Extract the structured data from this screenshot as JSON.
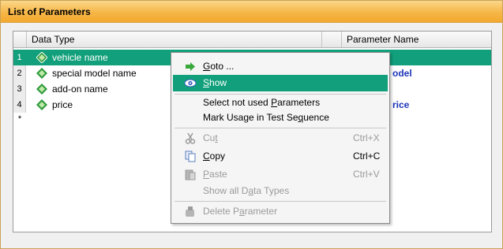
{
  "panel": {
    "title": "List of Parameters"
  },
  "table": {
    "columns": [
      "Data Type",
      "Parameter Name"
    ],
    "rows": [
      {
        "num": "1",
        "type": "vehicle name",
        "param": ""
      },
      {
        "num": "2",
        "type": "special model name",
        "param": "odel"
      },
      {
        "num": "3",
        "type": "add-on name",
        "param": ""
      },
      {
        "num": "4",
        "type": "price",
        "param": "rice"
      }
    ],
    "new_row_marker": "*"
  },
  "context_menu": {
    "goto": {
      "pre": "",
      "key": "G",
      "post": "oto ..."
    },
    "show": {
      "pre": "",
      "key": "S",
      "post": "how"
    },
    "select_unused": {
      "pre": "Select not used ",
      "key": "P",
      "post": "arameters"
    },
    "mark_usage": {
      "pre": "Mark Usage in Test Se",
      "key": "q",
      "post": "uence"
    },
    "cut": {
      "pre": "Cu",
      "key": "t",
      "post": "",
      "shortcut": "Ctrl+X"
    },
    "copy": {
      "pre": "",
      "key": "C",
      "post": "opy",
      "shortcut": "Ctrl+C"
    },
    "paste": {
      "pre": "",
      "key": "P",
      "post": "aste",
      "shortcut": "Ctrl+V"
    },
    "show_all": {
      "pre": "Show all D",
      "key": "a",
      "post": "ta Types"
    },
    "delete": {
      "pre": "Delete P",
      "key": "a",
      "post": "rameter"
    }
  },
  "colors": {
    "selection": "#11a07b",
    "header_orange": "#f6b648",
    "param_text": "#1b33b8"
  },
  "icons": {
    "row": "green-diamond-icon",
    "goto": "green-arrow-icon",
    "show": "eye-icon",
    "cut": "scissors-icon",
    "copy": "copy-icon",
    "paste": "paste-icon",
    "delete": "delete-icon"
  }
}
